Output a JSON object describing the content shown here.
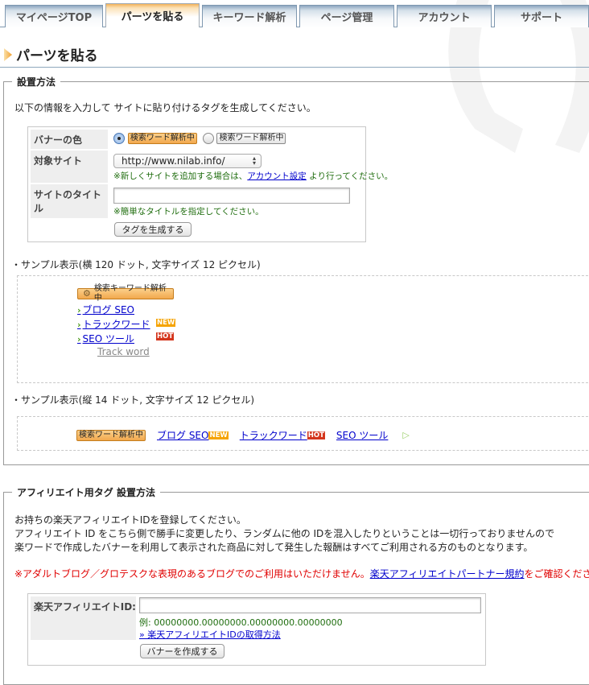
{
  "tabs": [
    {
      "label": "マイページTOP",
      "active": false
    },
    {
      "label": "パーツを貼る",
      "active": true
    },
    {
      "label": "キーワード解析",
      "active": false
    },
    {
      "label": "ページ管理",
      "active": false
    },
    {
      "label": "アカウント",
      "active": false
    },
    {
      "label": "サポート",
      "active": false
    }
  ],
  "page_title": "パーツを貼る",
  "setup": {
    "legend": "設置方法",
    "intro": "以下の情報を入力して サイトに貼り付けるタグを生成してください。",
    "form": {
      "banner_color_label": "バナーの色",
      "banner_options": [
        {
          "label": "検索ワード解析中",
          "style": "orange",
          "selected": true
        },
        {
          "label": "検索ワード解析中",
          "style": "gray",
          "selected": false
        }
      ],
      "target_site_label": "対象サイト",
      "target_site_value": "http://www.nilab.info/",
      "target_site_note_prefix": "※新しくサイトを追加する場合は、",
      "target_site_note_link": "アカウント設定",
      "target_site_note_suffix": " より行ってください。",
      "site_title_label": "サイトのタイトル",
      "site_title_value": "",
      "site_title_note": "※簡単なタイトルを指定してください。",
      "generate_button": "タグを生成する"
    },
    "sample_vertical": {
      "heading": "・サンプル表示(横 120 ドット, 文字サイズ 12 ピクセル)",
      "banner": "検索キーワード解析中",
      "links": [
        {
          "label": "ブログ SEO",
          "tag": ""
        },
        {
          "label": "トラックワード",
          "tag": "NEW"
        },
        {
          "label": "SEO ツール",
          "tag": "HOT"
        }
      ],
      "footer_link": "Track word"
    },
    "sample_horizontal": {
      "heading": "・サンプル表示(縦 14 ドット, 文字サイズ 12 ピクセル)",
      "banner": "検索ワード解析中",
      "links": [
        {
          "label": "ブログ SEO",
          "tag": "NEW"
        },
        {
          "label": "トラックワード",
          "tag": "HOT"
        },
        {
          "label": "SEO ツール",
          "tag": ""
        }
      ]
    }
  },
  "affiliate": {
    "legend": "アフィリエイト用タグ 設置方法",
    "lines": [
      "お持ちの楽天アフィリエイトIDを登録してください。",
      "アフィリエイト ID をこちら側で勝手に変更したり、ランダムに他の IDを混入したりということは一切行っておりませんので",
      "楽ワードで作成したバナーを利用して表示された商品に対して発生した報酬はすべてご利用される方のものとなります。"
    ],
    "warning_prefix": "※アダルトブログ／グロテスクな表現のあるブログでのご利用はいただけません。",
    "warning_link": "楽天アフィリエイトパートナー規約",
    "warning_suffix": "をご確認ください",
    "id_label": "楽天アフィリエイトID:",
    "id_value": "",
    "example": "例: 00000000.00000000.00000000.00000000",
    "howto_link": "» 楽天アフィリエイトIDの取得方法",
    "create_button": "バナーを作成する"
  },
  "colors": {
    "tab_border": "#7f98b0",
    "active_tab_accent": "#f3b35a",
    "note_green": "#1f6d0e",
    "warning_red": "#e00000",
    "link_blue": "#0000cc",
    "new_tag": "#f5a300",
    "hot_tag": "#d4351c"
  }
}
